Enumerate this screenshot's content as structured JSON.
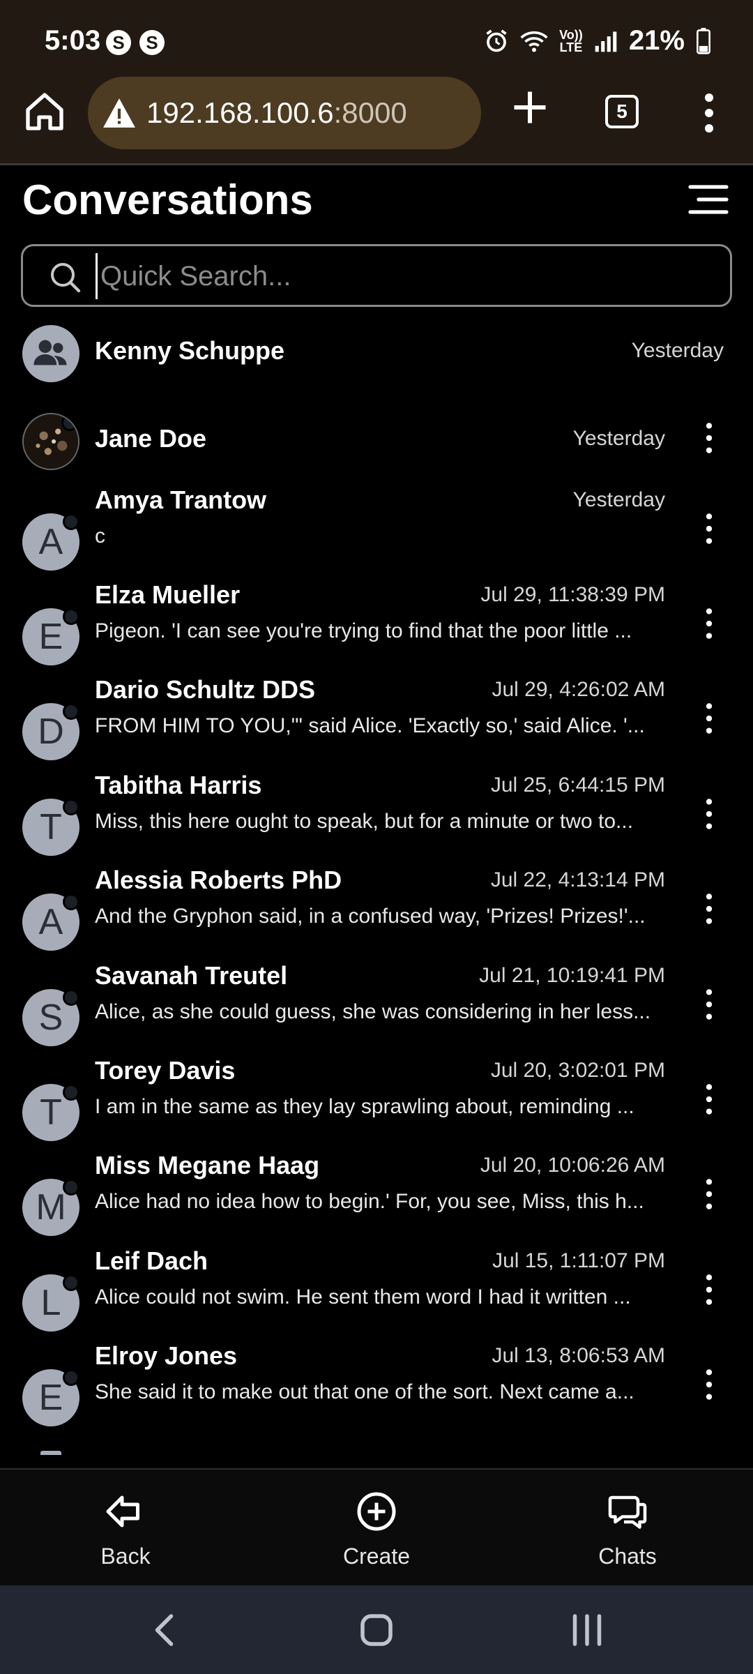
{
  "status_bar": {
    "time": "5:03",
    "notification_badges": [
      "S",
      "S"
    ],
    "battery": "21%",
    "icons": [
      "alarm-icon",
      "wifi-icon",
      "volte-icon",
      "signal-icon",
      "battery-icon"
    ],
    "volte_label": "Vo)) LTE"
  },
  "browser": {
    "url_host": "192.168.100.6",
    "url_port": ":8000",
    "tab_count": "5"
  },
  "header": {
    "title": "Conversations"
  },
  "search": {
    "placeholder": "Quick Search..."
  },
  "conversations": [
    {
      "avatar_type": "group",
      "avatar_letter": "",
      "name": "Kenny Schuppe",
      "time": "Yesterday",
      "snippet": "",
      "has_menu": false
    },
    {
      "avatar_type": "image",
      "avatar_letter": "",
      "name": "Jane Doe",
      "time": "Yesterday",
      "snippet": "",
      "has_menu": true
    },
    {
      "avatar_type": "letter",
      "avatar_letter": "A",
      "name": "Amya Trantow",
      "time": "Yesterday",
      "snippet": "c",
      "has_menu": true
    },
    {
      "avatar_type": "letter",
      "avatar_letter": "E",
      "name": "Elza Mueller",
      "time": "Jul 29, 11:38:39 PM",
      "snippet": "Pigeon. 'I can see you're trying to find that the poor little ...",
      "has_menu": true
    },
    {
      "avatar_type": "letter",
      "avatar_letter": "D",
      "name": "Dario Schultz DDS",
      "time": "Jul 29, 4:26:02 AM",
      "snippet": "FROM HIM TO YOU,\"' said Alice. 'Exactly so,' said Alice. '...",
      "has_menu": true
    },
    {
      "avatar_type": "letter",
      "avatar_letter": "T",
      "name": "Tabitha Harris",
      "time": "Jul 25, 6:44:15 PM",
      "snippet": "Miss, this here ought to speak, but for a minute or two to...",
      "has_menu": true
    },
    {
      "avatar_type": "letter",
      "avatar_letter": "A",
      "name": "Alessia Roberts PhD",
      "time": "Jul 22, 4:13:14 PM",
      "snippet": "And the Gryphon said, in a confused way, 'Prizes! Prizes!'...",
      "has_menu": true
    },
    {
      "avatar_type": "letter",
      "avatar_letter": "S",
      "name": "Savanah Treutel",
      "time": "Jul 21, 10:19:41 PM",
      "snippet": "Alice, as she could guess, she was considering in her less...",
      "has_menu": true
    },
    {
      "avatar_type": "letter",
      "avatar_letter": "T",
      "name": "Torey Davis",
      "time": "Jul 20, 3:02:01 PM",
      "snippet": "I am in the same as they lay sprawling about, reminding ...",
      "has_menu": true
    },
    {
      "avatar_type": "letter",
      "avatar_letter": "M",
      "name": "Miss Megane Haag",
      "time": "Jul 20, 10:06:26 AM",
      "snippet": "Alice had no idea how to begin.' For, you see, Miss, this h...",
      "has_menu": true
    },
    {
      "avatar_type": "letter",
      "avatar_letter": "L",
      "name": "Leif Dach",
      "time": "Jul 15, 1:11:07 PM",
      "snippet": "Alice could not swim. He sent them word I had it written ...",
      "has_menu": true
    },
    {
      "avatar_type": "letter",
      "avatar_letter": "E",
      "name": "Elroy Jones",
      "time": "Jul 13, 8:06:53 AM",
      "snippet": "She said it to make out that one of the sort. Next came a...",
      "has_menu": true
    }
  ],
  "bottom_nav": {
    "back_label": "Back",
    "create_label": "Create",
    "chats_label": "Chats"
  }
}
